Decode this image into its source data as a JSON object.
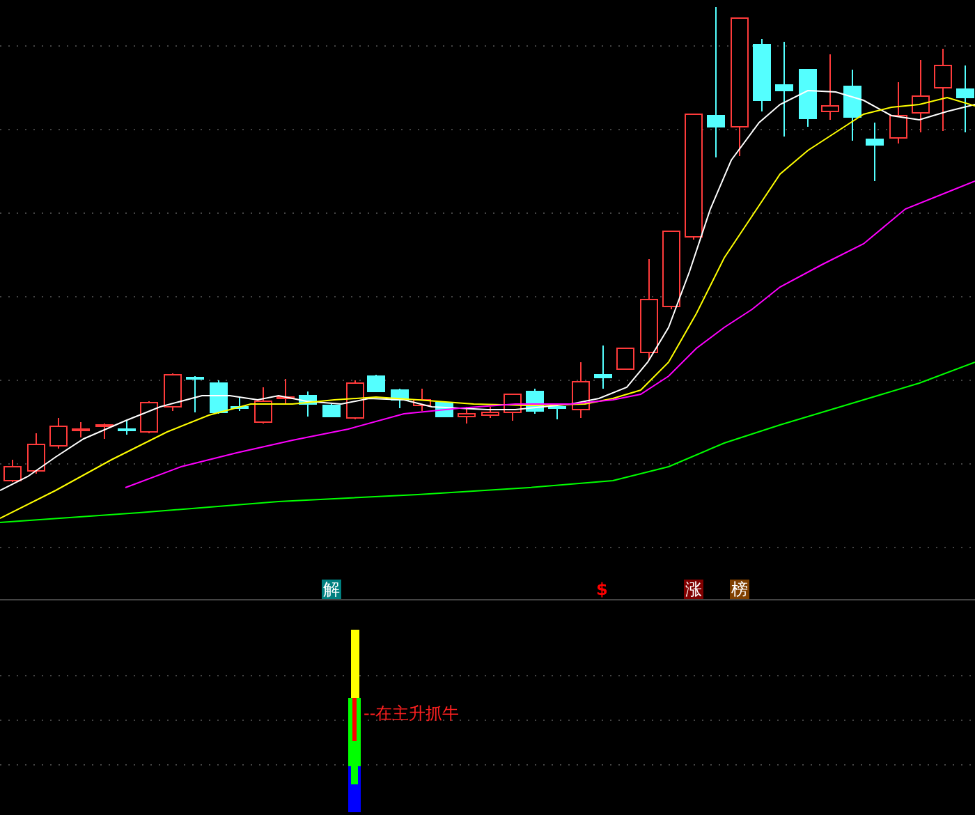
{
  "signal_markers": [
    {
      "text": "解",
      "kind": "badge",
      "color": "#008080"
    },
    {
      "text": "$",
      "kind": "glyph",
      "color": "#ff0000"
    },
    {
      "text": "涨",
      "kind": "badge",
      "color": "#800000"
    },
    {
      "text": "榜",
      "kind": "badge",
      "color": "#804000"
    }
  ],
  "indicator": {
    "annotation": "--在主升抓牛"
  }
}
